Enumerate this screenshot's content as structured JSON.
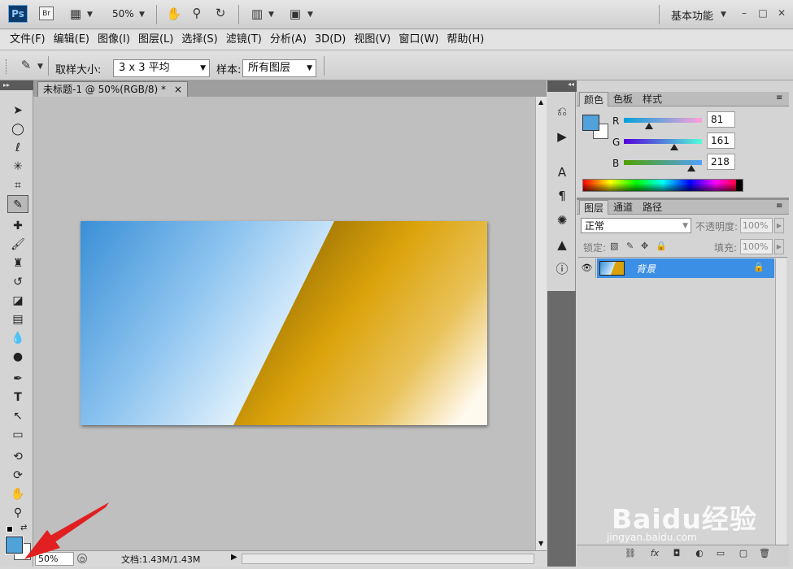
{
  "title_bar": {
    "app_badge": "Ps",
    "bridge_badge": "Br",
    "zoom": "50%",
    "workspace": "基本功能"
  },
  "menu": [
    "文件(F)",
    "编辑(E)",
    "图像(I)",
    "图层(L)",
    "选择(S)",
    "滤镜(T)",
    "分析(A)",
    "3D(D)",
    "视图(V)",
    "窗口(W)",
    "帮助(H)"
  ],
  "options": {
    "sample_size_label": "取样大小:",
    "sample_size_value": "3 x 3 平均",
    "sample_label": "样本:",
    "sample_value": "所有图层"
  },
  "document": {
    "tab_title": "未标题-1 @ 50%(RGB/8) *",
    "close_glyph": "×",
    "status_zoom": "50%",
    "status_doc": "文档:1.43M/1.43M"
  },
  "color_panel": {
    "tabs": [
      "颜色",
      "色板",
      "样式"
    ],
    "r_label": "R",
    "g_label": "G",
    "b_label": "B",
    "r": "81",
    "g": "161",
    "b": "218",
    "foreground_color": "#51a1da",
    "background_color": "#ffffff"
  },
  "layers_panel": {
    "tabs": [
      "图层",
      "通道",
      "路径"
    ],
    "blend_mode": "正常",
    "opacity_label": "不透明度:",
    "opacity_value": "100%",
    "lock_label": "锁定:",
    "fill_label": "填充:",
    "fill_value": "100%",
    "layer_name": "背景"
  },
  "watermark": {
    "brand": "Baidu经验",
    "url": "jingyan.baidu.com"
  },
  "colors": {
    "selection_blue": "#3b8fe4",
    "gradient_blue": "#3a8fd6",
    "gradient_gold": "#d9a10b"
  }
}
